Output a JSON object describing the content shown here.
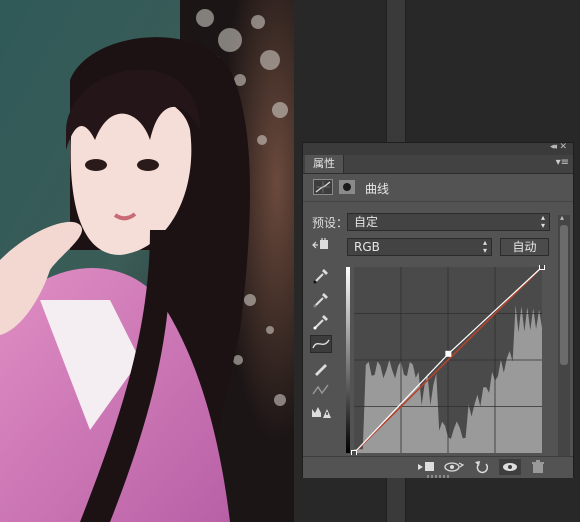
{
  "panel": {
    "tab_label": "属性",
    "title": "曲线",
    "preset_label": "预设：",
    "preset_value": "自定",
    "channel_value": "RGB",
    "auto_label": "自动"
  },
  "icons": [
    "collapse-icon",
    "panel-menu-icon",
    "curves-adjustment-icon",
    "layer-mask-icon",
    "on-image-adjust-hand-icon",
    "sample-black-eyedropper-icon",
    "sample-gray-eyedropper-icon",
    "sample-white-eyedropper-icon",
    "edit-points-curve-icon",
    "pencil-draw-icon",
    "smooth-curve-icon",
    "clipping-warning-icon",
    "clip-to-layer-icon",
    "view-previous-state-icon",
    "reset-icon",
    "visibility-eye-icon",
    "delete-trash-icon"
  ],
  "colors": {
    "panel_bg": "#535353",
    "curve_grid_bg": "#4a4a4a",
    "histogram": "#9a9a9a",
    "curve_line": "#ffffff",
    "baseline": "#b3442e"
  },
  "curve": {
    "baseline": [
      [
        0,
        0
      ],
      [
        255,
        255
      ]
    ],
    "points": [
      [
        0,
        0
      ],
      [
        128,
        136
      ],
      [
        255,
        255
      ]
    ]
  }
}
